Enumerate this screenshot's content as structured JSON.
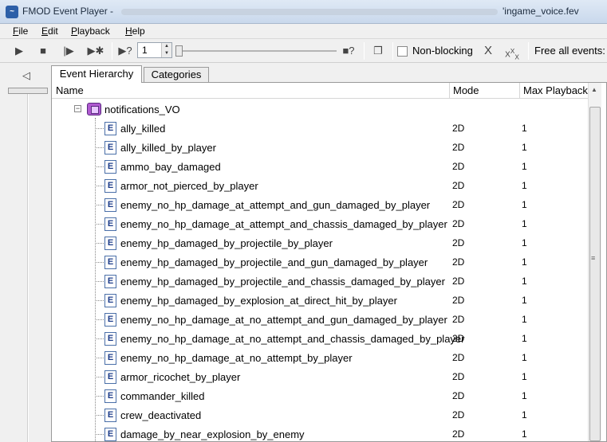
{
  "window": {
    "title": "FMOD Event Player -",
    "file": "'ingame_voice.fev"
  },
  "menu": [
    "File",
    "Edit",
    "Playback",
    "Help"
  ],
  "toolbar": {
    "play_icon": "play-icon",
    "stop_icon": "stop-icon",
    "step_icon": "step-icon",
    "spin_value": "1",
    "nonblocking_label": "Non-blocking",
    "nonblocking_checked": false,
    "free_label": "Free all events:"
  },
  "tabs": {
    "hierarchy": "Event Hierarchy",
    "categories": "Categories"
  },
  "columns": {
    "name": "Name",
    "mode": "Mode",
    "max": "Max Playback"
  },
  "group": {
    "name": "notifications_VO"
  },
  "events": [
    {
      "name": "ally_killed",
      "mode": "2D",
      "max": "1"
    },
    {
      "name": "ally_killed_by_player",
      "mode": "2D",
      "max": "1"
    },
    {
      "name": "ammo_bay_damaged",
      "mode": "2D",
      "max": "1"
    },
    {
      "name": "armor_not_pierced_by_player",
      "mode": "2D",
      "max": "1"
    },
    {
      "name": "enemy_no_hp_damage_at_attempt_and_gun_damaged_by_player",
      "mode": "2D",
      "max": "1"
    },
    {
      "name": "enemy_no_hp_damage_at_attempt_and_chassis_damaged_by_player",
      "mode": "2D",
      "max": "1"
    },
    {
      "name": "enemy_hp_damaged_by_projectile_by_player",
      "mode": "2D",
      "max": "1"
    },
    {
      "name": "enemy_hp_damaged_by_projectile_and_gun_damaged_by_player",
      "mode": "2D",
      "max": "1"
    },
    {
      "name": "enemy_hp_damaged_by_projectile_and_chassis_damaged_by_player",
      "mode": "2D",
      "max": "1"
    },
    {
      "name": "enemy_hp_damaged_by_explosion_at_direct_hit_by_player",
      "mode": "2D",
      "max": "1"
    },
    {
      "name": "enemy_no_hp_damage_at_no_attempt_and_gun_damaged_by_player",
      "mode": "2D",
      "max": "1"
    },
    {
      "name": "enemy_no_hp_damage_at_no_attempt_and_chassis_damaged_by_player",
      "mode": "2D",
      "max": "1"
    },
    {
      "name": "enemy_no_hp_damage_at_no_attempt_by_player",
      "mode": "2D",
      "max": "1"
    },
    {
      "name": "armor_ricochet_by_player",
      "mode": "2D",
      "max": "1"
    },
    {
      "name": "commander_killed",
      "mode": "2D",
      "max": "1"
    },
    {
      "name": "crew_deactivated",
      "mode": "2D",
      "max": "1"
    },
    {
      "name": "damage_by_near_explosion_by_enemy",
      "mode": "2D",
      "max": "1"
    }
  ]
}
